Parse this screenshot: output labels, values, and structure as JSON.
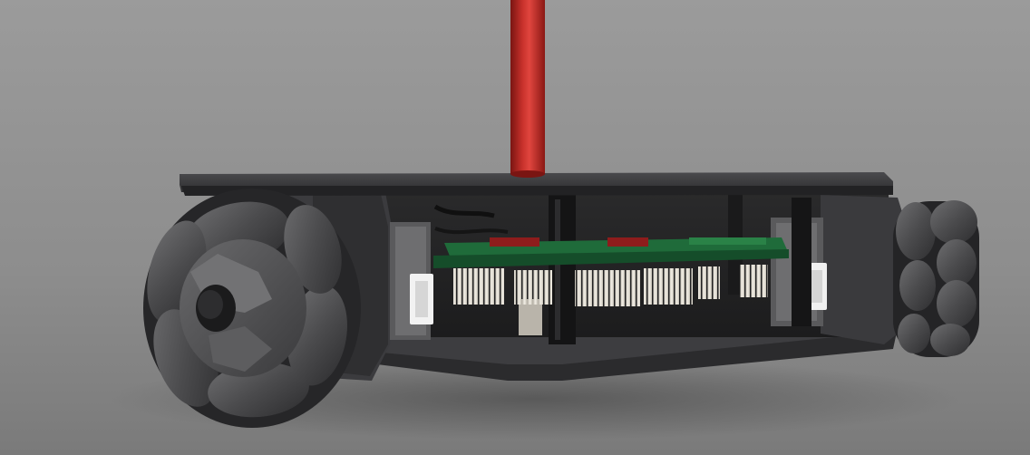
{
  "scene": {
    "kind": "3d-render",
    "subject": "omni-wheel-robot-chassis",
    "colors": {
      "background_top": "#9a9a9a",
      "background_bottom": "#777777",
      "plate": "#3a3a3c",
      "plate_edge": "#2a2a2c",
      "mast": "#b0201c",
      "mast_highlight": "#e0453e",
      "pcb": "#1f6b3a",
      "pcb_dark": "#154d2a",
      "pin_header": "#e6e1d6",
      "roller": "#4a4a4c",
      "roller_light": "#6a6a6c",
      "hub": "#5b5b5d",
      "connector": "#f2f2f2",
      "accent_red": "#8e1c1c"
    }
  }
}
